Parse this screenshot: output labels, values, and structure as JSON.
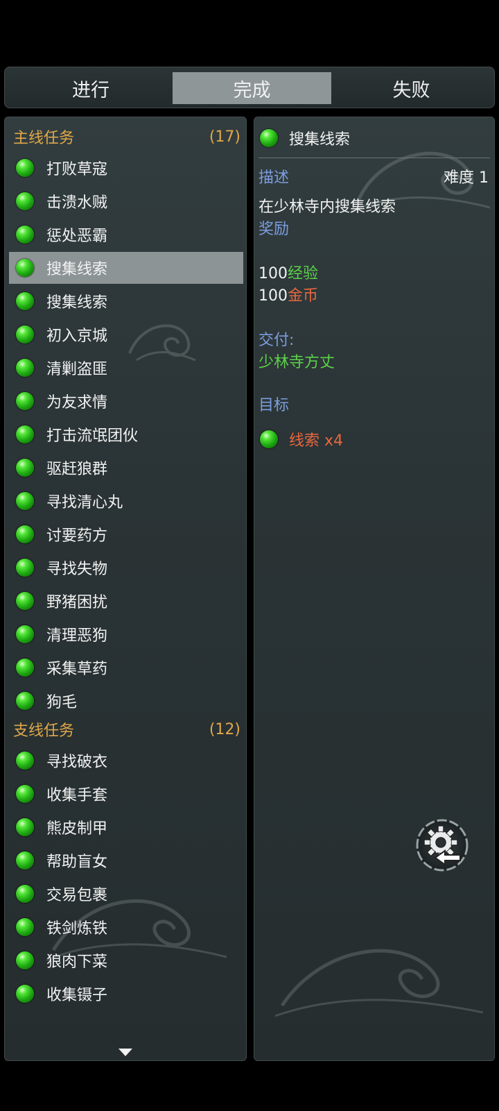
{
  "tabs": [
    {
      "label": "进行"
    },
    {
      "label": "完成"
    },
    {
      "label": "失败"
    }
  ],
  "main_section": {
    "title": "主线任务",
    "count": "(17)",
    "items": [
      {
        "label": "打败草寇"
      },
      {
        "label": "击溃水贼"
      },
      {
        "label": "惩处恶霸"
      },
      {
        "label": "搜集线索"
      },
      {
        "label": "搜集线索"
      },
      {
        "label": "初入京城"
      },
      {
        "label": "清剿盗匪"
      },
      {
        "label": "为友求情"
      },
      {
        "label": "打击流氓团伙"
      },
      {
        "label": "驱赶狼群"
      },
      {
        "label": "寻找清心丸"
      },
      {
        "label": "讨要药方"
      },
      {
        "label": "寻找失物"
      },
      {
        "label": "野猪困扰"
      },
      {
        "label": "清理恶狗"
      },
      {
        "label": "采集草药"
      },
      {
        "label": "狗毛"
      }
    ]
  },
  "side_section": {
    "title": "支线任务",
    "count": "(12)",
    "items": [
      {
        "label": "寻找破衣"
      },
      {
        "label": "收集手套"
      },
      {
        "label": "熊皮制甲"
      },
      {
        "label": "帮助盲女"
      },
      {
        "label": "交易包裹"
      },
      {
        "label": "铁剑炼铁"
      },
      {
        "label": "狼肉下菜"
      },
      {
        "label": "收集镊子"
      }
    ]
  },
  "detail": {
    "title": "搜集线索",
    "desc_label": "描述",
    "difficulty": "难度 1",
    "description": "在少林寺内搜集线索",
    "reward_label": "奖励",
    "reward_exp_value": "100",
    "reward_exp_unit": "经验",
    "reward_gold_value": "100",
    "reward_gold_unit": "金币",
    "submit_label": "交付:",
    "submit_npc": "少林寺方丈",
    "goal_label": "目标",
    "goal_item": "线索 x4"
  },
  "colors": {
    "accent_orange": "#e0a84a",
    "label_blue": "#7c9ee0",
    "value_green": "#5cd14a",
    "value_orange": "#e8673f",
    "selected_bg": "#8d9495"
  }
}
